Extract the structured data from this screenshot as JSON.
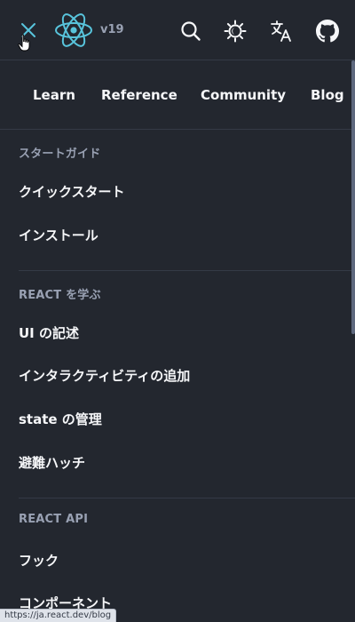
{
  "header": {
    "version": "v19",
    "icons": [
      "close-icon",
      "react-logo",
      "search-icon",
      "theme-toggle-icon",
      "language-icon",
      "github-icon"
    ]
  },
  "topnav": {
    "tabs": [
      "Learn",
      "Reference",
      "Community",
      "Blog"
    ]
  },
  "sidebar": {
    "sections": [
      {
        "title": "スタートガイド",
        "items": [
          "クイックスタート",
          "インストール"
        ]
      },
      {
        "title": "REACT を学ぶ",
        "items": [
          "UI の記述",
          "インタラクティビティの追加",
          "state の管理",
          "避難ハッチ"
        ]
      },
      {
        "title": "REACT API",
        "items": [
          "フック",
          "コンポーネント"
        ]
      }
    ]
  },
  "status_bar": {
    "url": "https://ja.react.dev/blog"
  },
  "colors": {
    "background": "#23272f",
    "accent": "#58c4dc",
    "text": "#f6f7f9",
    "muted": "#99a1b3",
    "divider": "#343a46"
  }
}
